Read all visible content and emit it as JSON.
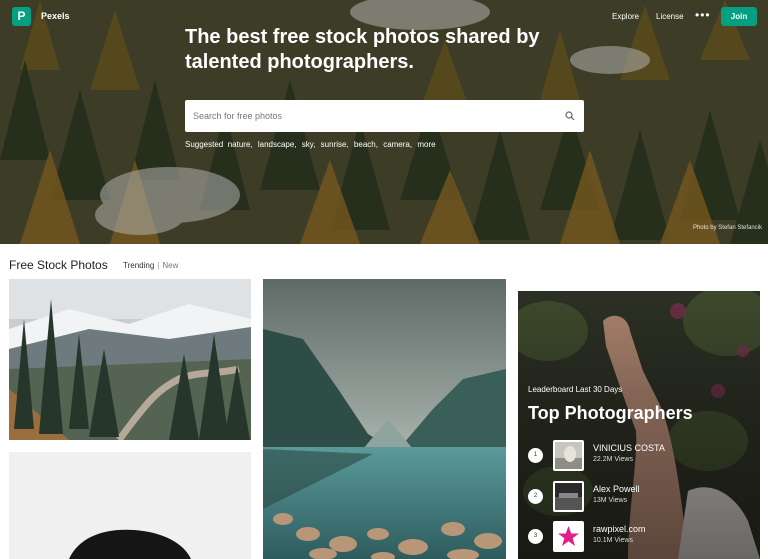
{
  "app": {
    "name": "Pexels"
  },
  "nav": {
    "explore": "Explore",
    "license": "License",
    "more": "•••",
    "join": "Join"
  },
  "hero": {
    "title": "The best free stock photos shared by talented photographers.",
    "search_placeholder": "Search for free photos",
    "suggested_label": "Suggested",
    "suggested_tags": [
      "nature,",
      "landscape,",
      "sky,",
      "sunrise,",
      "beach,",
      "camera,",
      "more"
    ],
    "credit": "Photo by Stefan Stefancik"
  },
  "feed": {
    "title": "Free Stock Photos",
    "filter_trending": "Trending",
    "filter_sep": "|",
    "filter_new": "New"
  },
  "leaderboard": {
    "subtitle": "Leaderboard Last 30 Days",
    "title": "Top Photographers",
    "entries": [
      {
        "rank": "1",
        "name": "VINICIUS COSTA",
        "views": "22.2M Views"
      },
      {
        "rank": "2",
        "name": "Alex Powell",
        "views": "13M Views"
      },
      {
        "rank": "3",
        "name": "rawpixel.com",
        "views": "10.1M Views"
      }
    ]
  },
  "colors": {
    "accent": "#05a081"
  }
}
